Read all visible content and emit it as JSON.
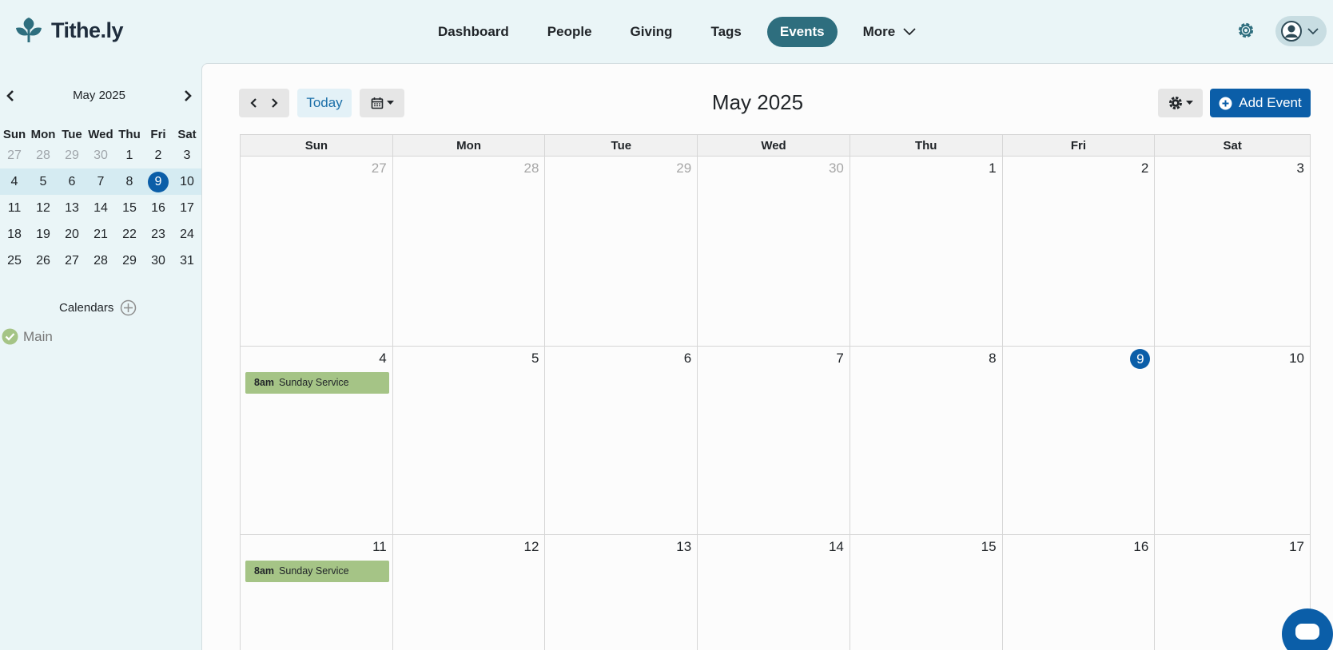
{
  "brand": {
    "name": "Tithe.ly"
  },
  "nav": {
    "items": [
      "Dashboard",
      "People",
      "Giving",
      "Tags",
      "Events"
    ],
    "more": "More",
    "active": "Events"
  },
  "mini_calendar": {
    "title": "May 2025",
    "weekdays": [
      "Sun",
      "Mon",
      "Tue",
      "Wed",
      "Thu",
      "Fri",
      "Sat"
    ],
    "weeks": [
      [
        "27",
        "28",
        "29",
        "30",
        "1",
        "2",
        "3"
      ],
      [
        "4",
        "5",
        "6",
        "7",
        "8",
        "9",
        "10"
      ],
      [
        "11",
        "12",
        "13",
        "14",
        "15",
        "16",
        "17"
      ],
      [
        "18",
        "19",
        "20",
        "21",
        "22",
        "23",
        "24"
      ],
      [
        "25",
        "26",
        "27",
        "28",
        "29",
        "30",
        "31"
      ]
    ],
    "today": "9"
  },
  "calendars": {
    "heading": "Calendars",
    "items": [
      {
        "name": "Main",
        "color": "#a5c486"
      }
    ]
  },
  "toolbar": {
    "today_label": "Today",
    "title": "May 2025",
    "add_event_label": "Add Event"
  },
  "month_grid": {
    "weekdays": [
      "Sun",
      "Mon",
      "Tue",
      "Wed",
      "Thu",
      "Fri",
      "Sat"
    ],
    "weeks": [
      [
        "27",
        "28",
        "29",
        "30",
        "1",
        "2",
        "3"
      ],
      [
        "4",
        "5",
        "6",
        "7",
        "8",
        "9",
        "10"
      ],
      [
        "11",
        "12",
        "13",
        "14",
        "15",
        "16",
        "17"
      ]
    ],
    "events": [
      {
        "date": "4",
        "time": "8am",
        "title": "Sunday Service"
      },
      {
        "date": "11",
        "time": "8am",
        "title": "Sunday Service"
      }
    ]
  },
  "colors": {
    "accent": "#0b5ea8",
    "nav_active": "#2e6e7e",
    "event": "#a5c486"
  }
}
